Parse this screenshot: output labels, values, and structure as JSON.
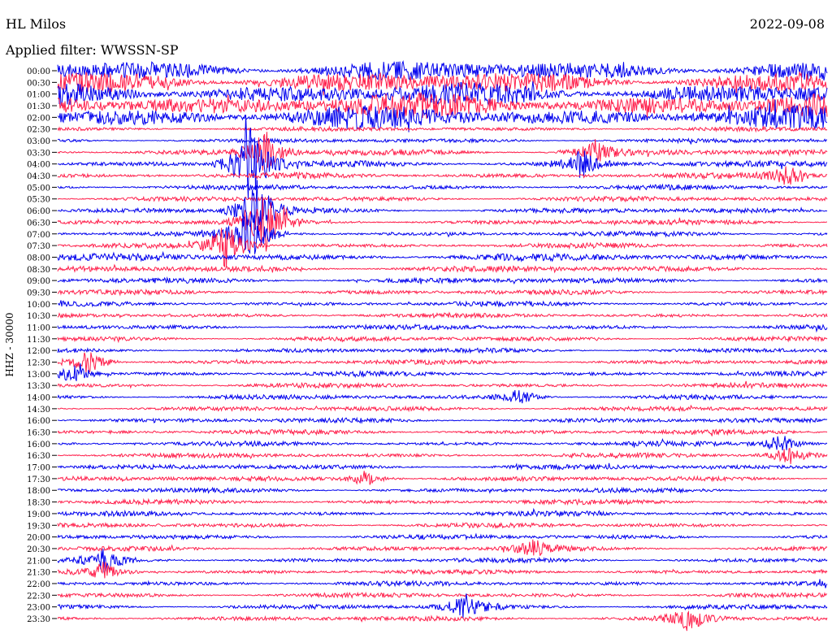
{
  "header": {
    "station": "HL Milos",
    "date": "2022-09-08",
    "filter": "Applied filter: WWSSN-SP"
  },
  "chart_data": {
    "type": "line",
    "title": "HL Milos",
    "subtitle": "Applied filter: WWSSN-SP",
    "ylabel": "HHZ - 30000",
    "xlabel": "",
    "categories": [
      "00:00",
      "00:30",
      "01:00",
      "01:30",
      "02:00",
      "02:30",
      "03:00",
      "03:30",
      "04:00",
      "04:30",
      "05:00",
      "05:30",
      "06:00",
      "06:30",
      "07:00",
      "07:30",
      "08:00",
      "08:30",
      "09:00",
      "09:30",
      "10:00",
      "10:30",
      "11:00",
      "11:30",
      "12:00",
      "12:30",
      "13:00",
      "13:30",
      "14:00",
      "14:30",
      "15:00",
      "15:30",
      "16:00",
      "16:30",
      "17:00",
      "17:30",
      "18:00",
      "18:30",
      "19:00",
      "19:30",
      "20:00",
      "20:30",
      "21:00",
      "21:30",
      "22:00",
      "22:30",
      "23:00",
      "23:30"
    ],
    "tick_labels": [
      "00:00",
      "00:30",
      "01:00",
      "01:30",
      "02:00",
      "02:30",
      "03:00",
      "03:30",
      "04:00",
      "04:30",
      "05:00",
      "05:30",
      "06:00",
      "06:30",
      "07:00",
      "07:30",
      "08:00",
      "08:30",
      "09:00",
      "09:30",
      "10:00",
      "10:30",
      "11:00",
      "11:30",
      "12:00",
      "12:30",
      "13:00",
      "13:30",
      "14:00",
      "14:30",
      "16:00",
      "16:30",
      "16:00",
      "16:30",
      "17:00",
      "17:30",
      "18:00",
      "18:30",
      "19:00",
      "19:30",
      "20:00",
      "20:30",
      "21:00",
      "21:30",
      "22:00",
      "22:30",
      "23:00",
      "23:30"
    ],
    "series": [
      {
        "color": "#0000ee"
      },
      {
        "color": "#ff1f4b"
      }
    ],
    "colors": {
      "blue": "#0000ee",
      "red": "#ff1f4b"
    },
    "amplitude": [
      1.6,
      1.7,
      1.8,
      2.0,
      1.8,
      0.35,
      0.35,
      0.5,
      0.5,
      0.45,
      0.4,
      0.4,
      0.42,
      0.42,
      0.4,
      0.4,
      0.6,
      0.5,
      0.45,
      0.4,
      0.4,
      0.38,
      0.4,
      0.38,
      0.38,
      0.38,
      0.38,
      0.38,
      0.38,
      0.38,
      0.38,
      0.38,
      0.38,
      0.38,
      0.4,
      0.4,
      0.38,
      0.38,
      0.38,
      0.38,
      0.38,
      0.38,
      0.38,
      0.38,
      0.38,
      0.38,
      0.4,
      0.4
    ],
    "events": [
      {
        "trace": 7,
        "x": 0.27,
        "amp": 3.2
      },
      {
        "trace": 8,
        "x": 0.25,
        "amp": 6.0
      },
      {
        "trace": 12,
        "x": 0.26,
        "amp": 4.5
      },
      {
        "trace": 13,
        "x": 0.27,
        "amp": 4.0
      },
      {
        "trace": 14,
        "x": 0.25,
        "amp": 3.8
      },
      {
        "trace": 15,
        "x": 0.22,
        "amp": 3.5
      },
      {
        "trace": 7,
        "x": 0.7,
        "amp": 1.8
      },
      {
        "trace": 8,
        "x": 0.68,
        "amp": 2.0
      },
      {
        "trace": 9,
        "x": 0.95,
        "amp": 1.5
      },
      {
        "trace": 25,
        "x": 0.04,
        "amp": 1.8
      },
      {
        "trace": 26,
        "x": 0.02,
        "amp": 1.4
      },
      {
        "trace": 35,
        "x": 0.4,
        "amp": 1.2
      },
      {
        "trace": 42,
        "x": 0.06,
        "amp": 1.6
      },
      {
        "trace": 43,
        "x": 0.06,
        "amp": 1.4
      },
      {
        "trace": 46,
        "x": 0.53,
        "amp": 1.8
      },
      {
        "trace": 47,
        "x": 0.82,
        "amp": 1.8
      },
      {
        "trace": 32,
        "x": 0.94,
        "amp": 1.4
      },
      {
        "trace": 33,
        "x": 0.95,
        "amp": 1.3
      },
      {
        "trace": 28,
        "x": 0.6,
        "amp": 1.2
      },
      {
        "trace": 41,
        "x": 0.62,
        "amp": 1.2
      }
    ],
    "grid": false,
    "legend": "none"
  }
}
